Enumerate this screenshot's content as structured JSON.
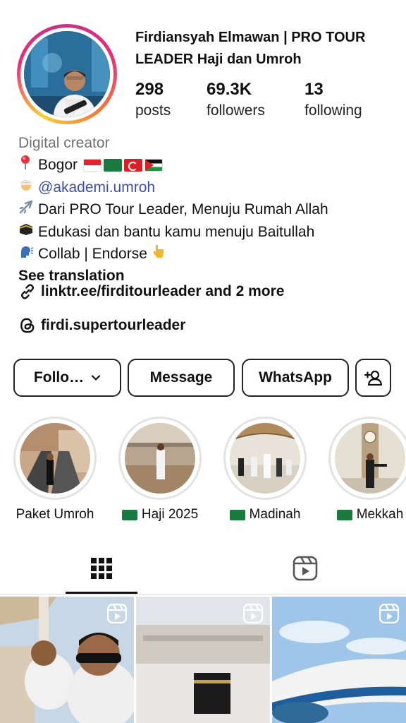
{
  "profile": {
    "name": "Firdiansyah Elmawan | PRO TOUR LEADER Haji dan Umroh",
    "stats": [
      {
        "value": "298",
        "label": "posts"
      },
      {
        "value": "69.3K",
        "label": "followers"
      },
      {
        "value": "13",
        "label": "following"
      }
    ]
  },
  "bio": {
    "category": "Digital creator",
    "location": "Bogor",
    "mention": "@akademi.umroh",
    "line_travel": "Dari PRO Tour Leader, Menuju Rumah Allah",
    "line_kaaba": "Edukasi dan bantu kamu menuju Baitullah",
    "line_collab": "Collab | Endorse",
    "see_translation": "See translation",
    "link": "linktr.ee/firditourleader and 2 more",
    "threads": "firdi.supertourleader"
  },
  "actions": {
    "follow": "Follo…",
    "message": "Message",
    "whatsapp": "WhatsApp"
  },
  "highlights": [
    {
      "label": "Paket Umroh"
    },
    {
      "label": "Haji 2025"
    },
    {
      "label": "Madinah"
    },
    {
      "label": "Mekkah"
    }
  ],
  "icons": {
    "location": "pin-icon",
    "mention": "man-turban-icon",
    "travel": "airplane-icon",
    "kaaba": "kaaba-icon",
    "collab": "speaking-head-icon",
    "pointing": "pointing-down-icon",
    "link": "link-icon",
    "threads": "threads-icon",
    "grid": "grid-icon",
    "reels": "reels-icon",
    "add_user": "add-user-icon"
  },
  "colors": {
    "mention": "#3b4fa8",
    "category": "#707070",
    "ring_start": "#f9ce34",
    "ring_mid": "#ee2a7b"
  }
}
